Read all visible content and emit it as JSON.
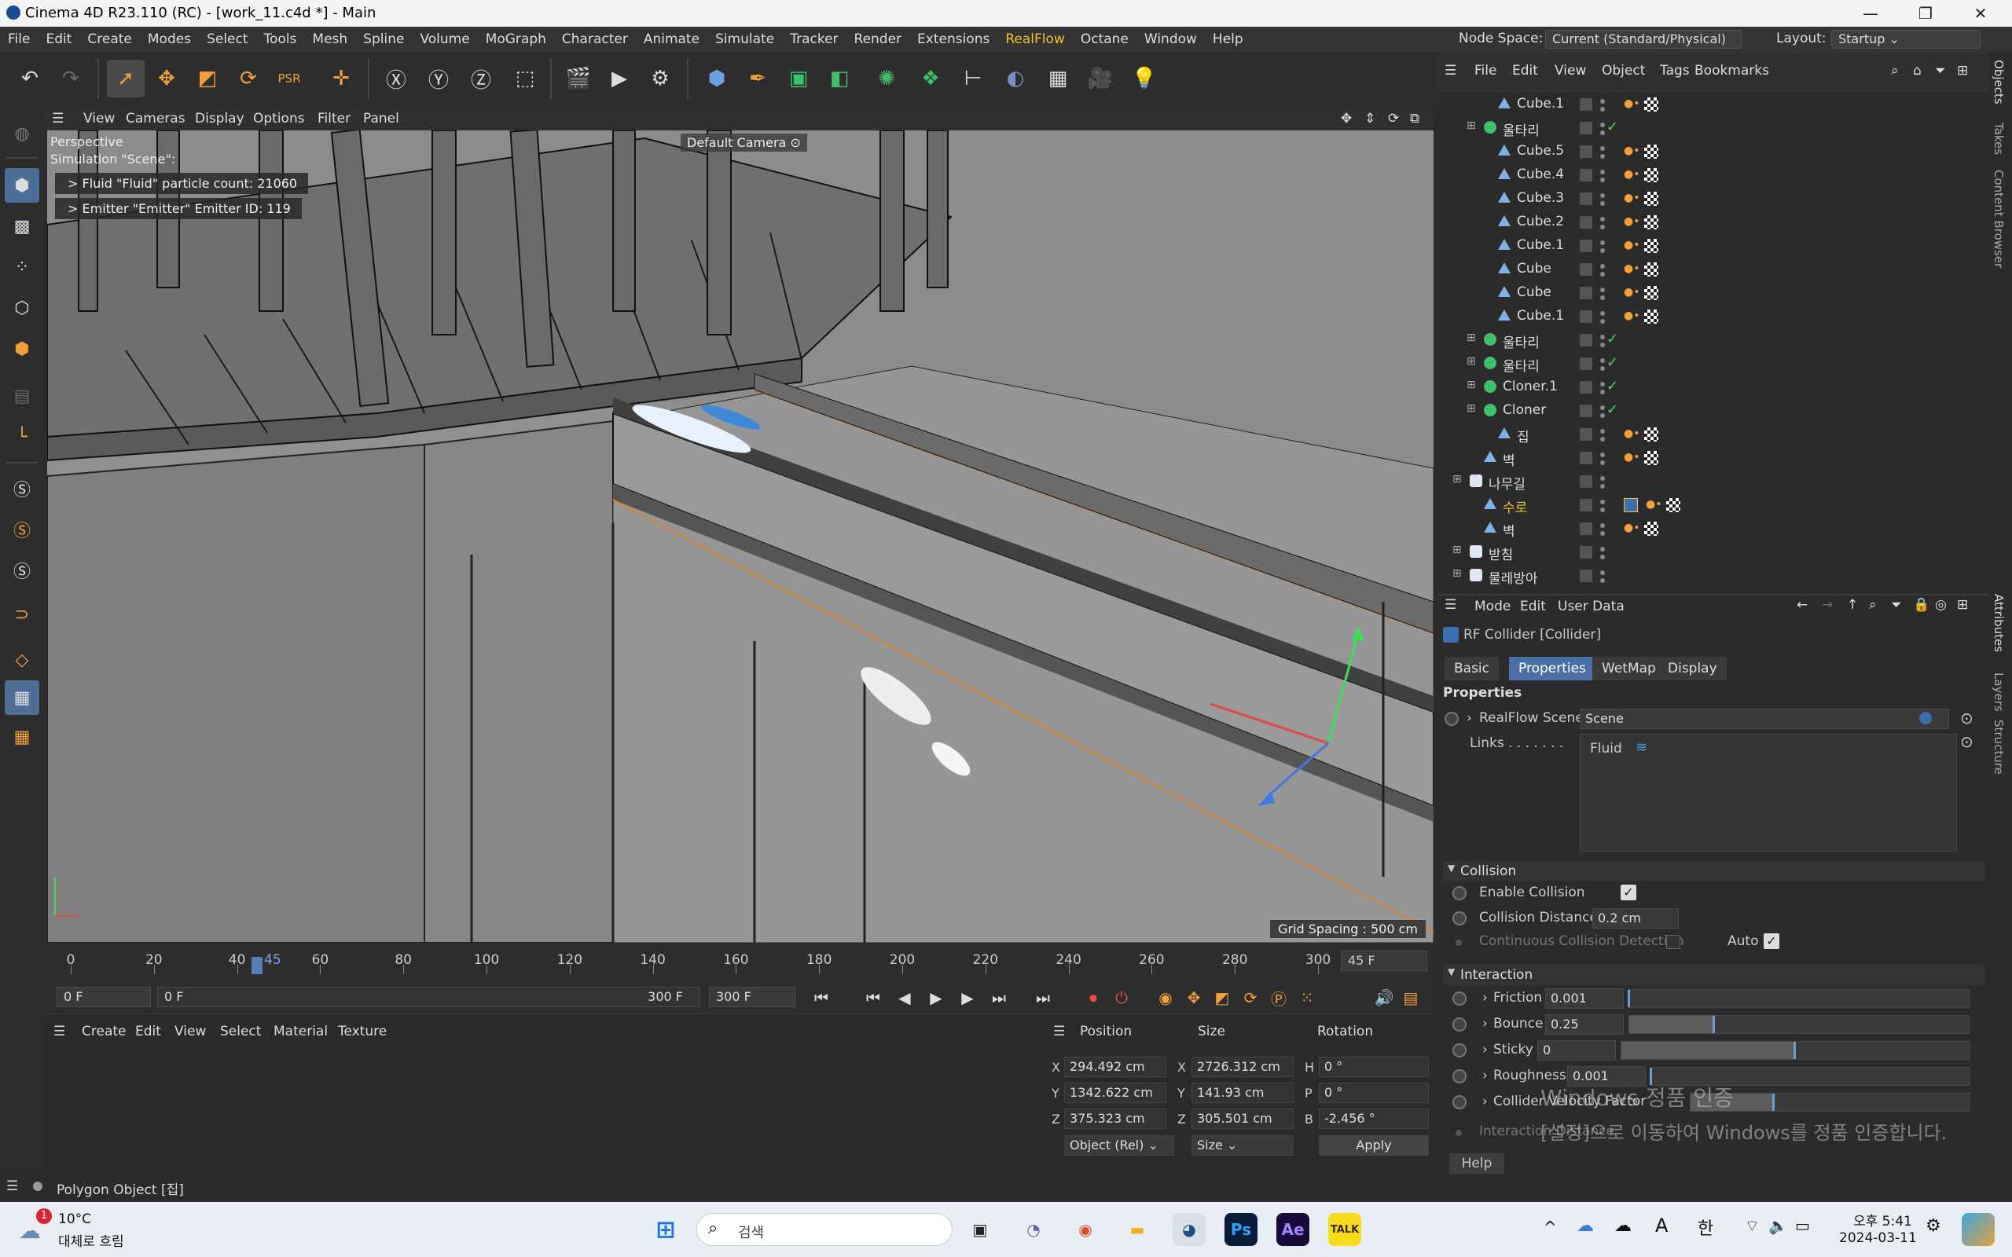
{
  "title": "Cinema 4D R23.110 (RC) - [work_11.c4d *] - Main",
  "menu": [
    "File",
    "Edit",
    "Create",
    "Modes",
    "Select",
    "Tools",
    "Mesh",
    "Spline",
    "Volume",
    "MoGraph",
    "Character",
    "Animate",
    "Simulate",
    "Tracker",
    "Render",
    "Extensions",
    "RealFlow",
    "Octane",
    "Window",
    "Help"
  ],
  "node_space": {
    "label": "Node Space:",
    "value": "Current (Standard/Physical)"
  },
  "layout": {
    "label": "Layout:",
    "value": "Startup"
  },
  "viewport_menu": [
    "View",
    "Cameras",
    "Display",
    "Options",
    "Filter",
    "Panel"
  ],
  "viewport": {
    "projection": "Perspective",
    "simulation": "Simulation \"Scene\":",
    "hud1": "> Fluid \"Fluid\" particle count: 21060",
    "hud2": "> Emitter \"Emitter\" Emitter ID: 119",
    "camera": "Default Camera",
    "grid": "Grid Spacing : 500 cm"
  },
  "timeline": {
    "ticks": [
      "0",
      "20",
      "40",
      "60",
      "80",
      "100",
      "120",
      "140",
      "160",
      "180",
      "200",
      "220",
      "240",
      "260",
      "280",
      "300"
    ],
    "current_marker": "45",
    "end_display": "45 F",
    "start_field": "0 F",
    "range_start": "0 F",
    "range_end": "300 F",
    "end_field": "300 F"
  },
  "material_menu": [
    "Create",
    "Edit",
    "View",
    "Select",
    "Material",
    "Texture"
  ],
  "coords": {
    "headers": [
      "Position",
      "Size",
      "Rotation"
    ],
    "rows": [
      {
        "axis": "X",
        "pos": "294.492 cm",
        "saxis": "X",
        "size": "2726.312 cm",
        "raxis": "H",
        "rot": "0 °"
      },
      {
        "axis": "Y",
        "pos": "1342.622 cm",
        "saxis": "Y",
        "size": "141.93 cm",
        "raxis": "P",
        "rot": "0 °"
      },
      {
        "axis": "Z",
        "pos": "375.323 cm",
        "saxis": "Z",
        "size": "305.501 cm",
        "raxis": "B",
        "rot": "-2.456 °"
      }
    ],
    "mode": "Object (Rel)",
    "size_mode": "Size",
    "apply": "Apply"
  },
  "status": "Polygon Object [집]",
  "object_menu": [
    "File",
    "Edit",
    "View",
    "Object",
    "Tags",
    "Bookmarks"
  ],
  "objects": [
    {
      "name": "Cube.1",
      "type": "cube",
      "indent": 2,
      "tags": true,
      "check": false
    },
    {
      "name": "울타리",
      "type": "cloner",
      "indent": 1,
      "tags": false,
      "check": true
    },
    {
      "name": "Cube.5",
      "type": "cube",
      "indent": 2,
      "tags": true,
      "check": false
    },
    {
      "name": "Cube.4",
      "type": "cube",
      "indent": 2,
      "tags": true,
      "check": false
    },
    {
      "name": "Cube.3",
      "type": "cube",
      "indent": 2,
      "tags": true,
      "check": false
    },
    {
      "name": "Cube.2",
      "type": "cube",
      "indent": 2,
      "tags": true,
      "check": false
    },
    {
      "name": "Cube.1",
      "type": "cube",
      "indent": 2,
      "tags": true,
      "check": false
    },
    {
      "name": "Cube",
      "type": "cube",
      "indent": 2,
      "tags": true,
      "check": false
    },
    {
      "name": "Cube",
      "type": "cube",
      "indent": 2,
      "tags": true,
      "check": false
    },
    {
      "name": "Cube.1",
      "type": "cube",
      "indent": 2,
      "tags": true,
      "check": false
    },
    {
      "name": "울타리",
      "type": "cloner",
      "indent": 1,
      "tags": false,
      "check": true
    },
    {
      "name": "울타리",
      "type": "cloner",
      "indent": 1,
      "tags": false,
      "check": true
    },
    {
      "name": "Cloner.1",
      "type": "cloner",
      "indent": 1,
      "tags": false,
      "check": true
    },
    {
      "name": "Cloner",
      "type": "cloner",
      "indent": 1,
      "tags": false,
      "check": true
    },
    {
      "name": "집",
      "type": "cube",
      "indent": 2,
      "tags": true,
      "check": false
    },
    {
      "name": "벽",
      "type": "cube",
      "indent": 1,
      "tags": true,
      "check": false
    },
    {
      "name": "나무길",
      "type": "null",
      "indent": 0,
      "tags": false,
      "check": false
    },
    {
      "name": "수로",
      "type": "cube",
      "indent": 1,
      "tags": true,
      "check": false,
      "selected": true
    },
    {
      "name": "벽",
      "type": "cube",
      "indent": 1,
      "tags": true,
      "check": false
    },
    {
      "name": "받침",
      "type": "null",
      "indent": 0,
      "tags": false,
      "check": false
    },
    {
      "name": "물레방아",
      "type": "null",
      "indent": 0,
      "tags": false,
      "check": false
    }
  ],
  "attr_menu": [
    "Mode",
    "Edit",
    "User Data"
  ],
  "attr": {
    "object_title": "RF Collider [Collider]",
    "tabs": [
      "Basic",
      "Properties",
      "WetMap",
      "Display"
    ],
    "active_tab": "Properties",
    "properties_header": "Properties",
    "rf_scene_label": "RealFlow Scene",
    "rf_scene_value": "Scene",
    "links_label": "Links . . . . . . .",
    "links_value": "Fluid",
    "collision_header": "Collision",
    "enable_collision": "Enable Collision",
    "collision_distance": "Collision Distance",
    "collision_distance_value": "0.2 cm",
    "continuous": "Continuous Collision Detection",
    "auto": "Auto",
    "interaction_header": "Interaction",
    "params": [
      {
        "label": "Friction",
        "value": "0.001",
        "fraction": 0.0
      },
      {
        "label": "Bounce",
        "value": "0.25",
        "fraction": 0.25
      },
      {
        "label": "Sticky",
        "value": "0",
        "fraction": 0.5
      },
      {
        "label": "Roughness",
        "value": "0.001",
        "fraction": 0.0
      },
      {
        "label": "Collider Velocity Factor",
        "value": "1",
        "fraction": 0.3
      }
    ],
    "interaction_partial": "Interaction Distance",
    "help": "Help"
  },
  "right_tabs": [
    "Objects",
    "Takes",
    "Content Browser",
    "Attributes",
    "Layers",
    "Structure"
  ],
  "watermark": {
    "line1": "Windows 정품 인증",
    "line2": "[설정]으로 이동하여 Windows를 정품 인증합니다."
  },
  "taskbar": {
    "weather_badge": "1",
    "temp": "10°C",
    "weather": "대체로 흐림",
    "search": "검색",
    "ime": "한",
    "time": "오후 5:41",
    "date": "2024-03-11"
  },
  "colors": {
    "accent": "#4a6fa5",
    "realflow": "#f2c230",
    "viewport": "#8a8a8a",
    "orange_edge": "#d9822b"
  }
}
